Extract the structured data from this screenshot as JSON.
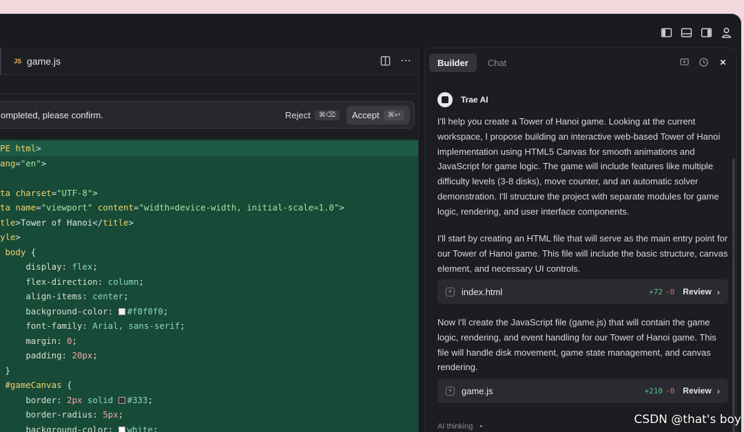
{
  "titlebar": {
    "icons": [
      "layout-left-icon",
      "layout-bottom-icon",
      "layout-right-icon",
      "user-icon"
    ]
  },
  "editor": {
    "tab": {
      "badge": "JS",
      "label": "game.js"
    },
    "confirm": {
      "text": "ompleted, please confirm.",
      "reject_label": "Reject",
      "reject_shortcut": "⌘⌫",
      "accept_label": "Accept",
      "accept_shortcut": "⌘↩"
    }
  },
  "panel": {
    "tabs": [
      {
        "label": "Builder",
        "active": true
      },
      {
        "label": "Chat",
        "active": false
      }
    ],
    "author": "Trae AI",
    "messages": [
      "I'll help you create a Tower of Hanoi game. Looking at the current workspace, I propose building an interactive web-based Tower of Hanoi implementation using HTML5 Canvas for smooth animations and JavaScript for game logic. The game will include features like multiple difficulty levels (3-8 disks), move counter, and an automatic solver demonstration. I'll structure the project with separate modules for game logic, rendering, and user interface components.",
      "I'll start by creating an HTML file that will serve as the main entry point for our Tower of Hanoi game. This file will include the basic structure, canvas element, and necessary UI controls.",
      "Now I'll create the JavaScript file (game.js) that will contain the game logic, rendering, and event handling for our Tower of Hanoi game. This file will handle disk movement, game state management, and canvas rendering."
    ],
    "files": [
      {
        "name": "index.html",
        "added": "+72",
        "removed": "-0",
        "review": "Review"
      },
      {
        "name": "game.js",
        "added": "+210",
        "removed": "-0",
        "review": "Review"
      }
    ],
    "thinking": "AI thinking",
    "thinking_dot": "•"
  },
  "watermark": "CSDN @that's boy"
}
